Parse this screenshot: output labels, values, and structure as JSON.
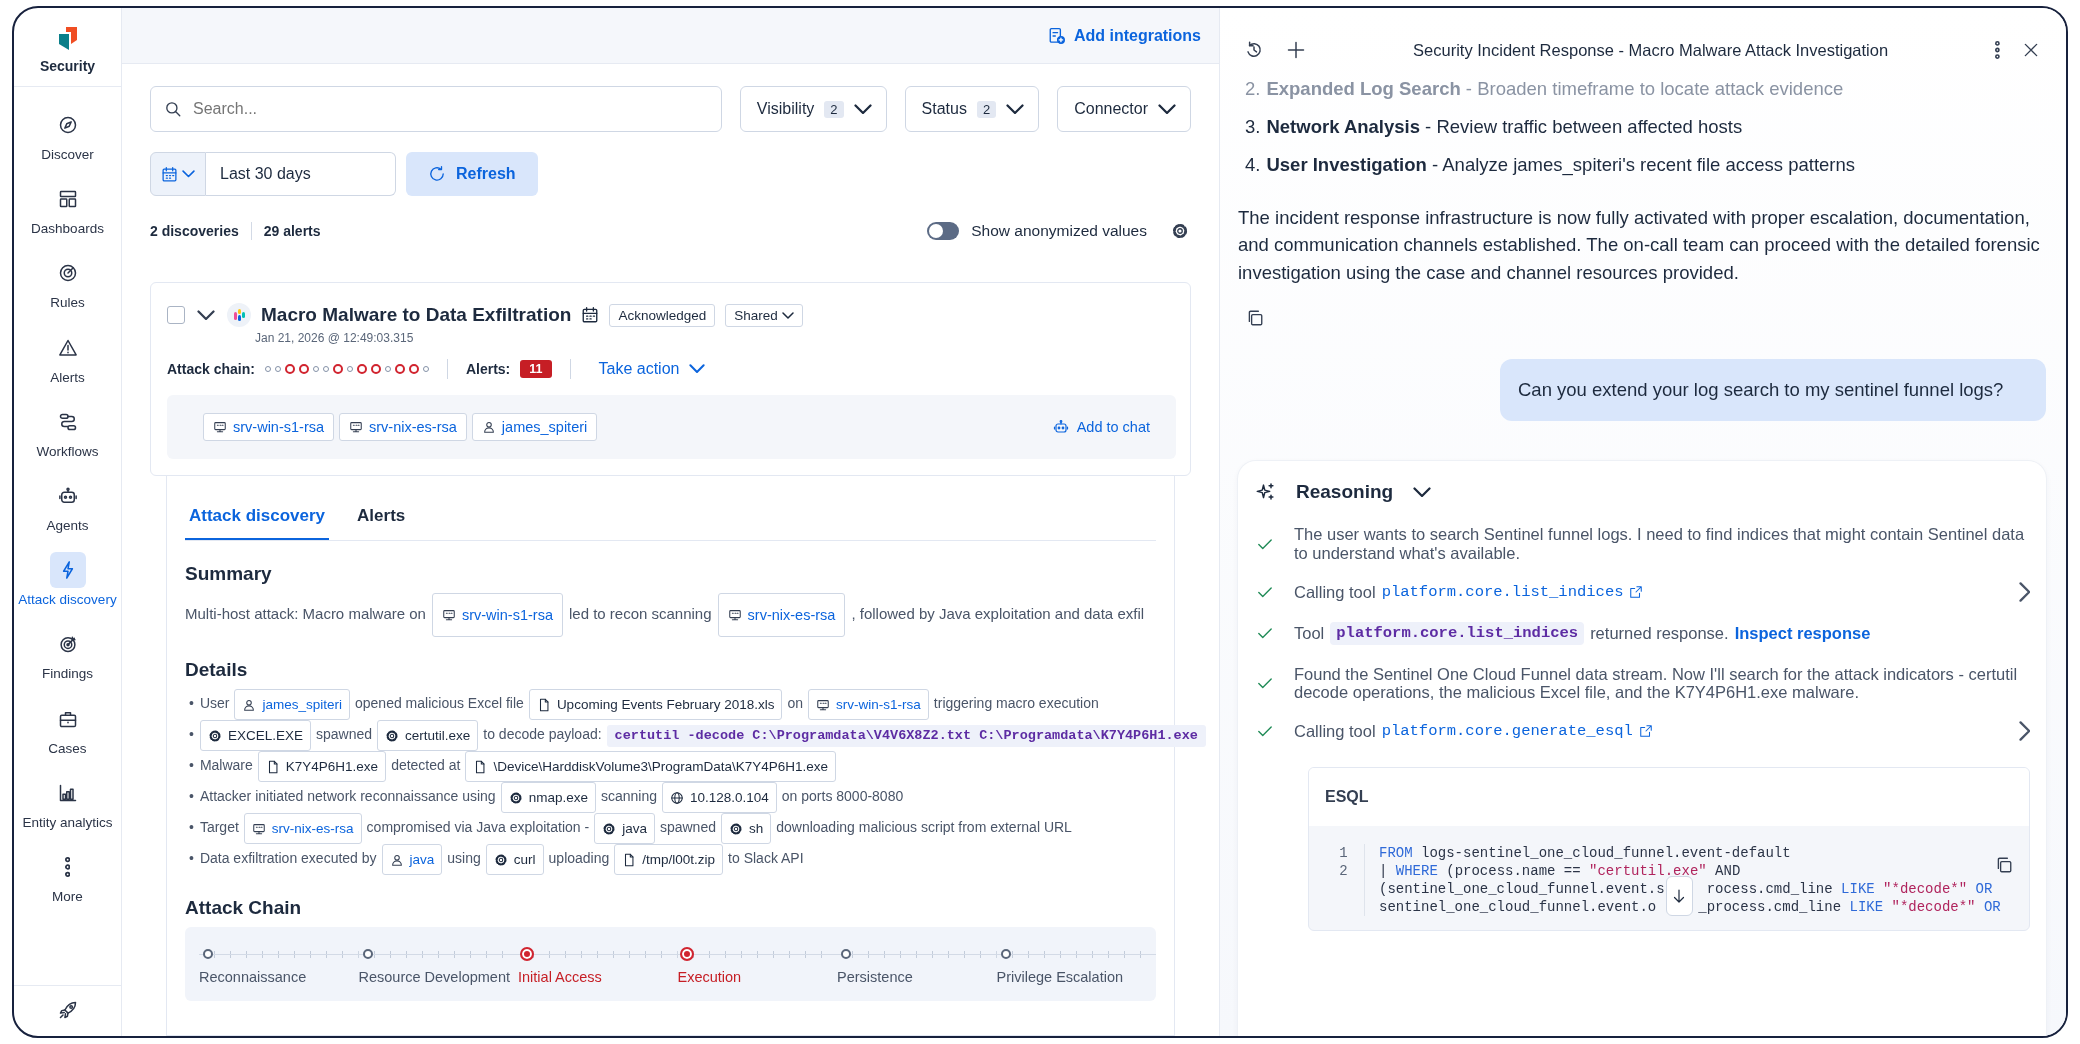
{
  "sidebar": {
    "app_name": "Security",
    "items": [
      {
        "label": "Discover",
        "selected": false
      },
      {
        "label": "Dashboards",
        "selected": false
      },
      {
        "label": "Rules",
        "selected": false
      },
      {
        "label": "Alerts",
        "selected": false
      },
      {
        "label": "Workflows",
        "selected": false
      },
      {
        "label": "Agents",
        "selected": false
      },
      {
        "label": "Attack discovery",
        "selected": true
      },
      {
        "label": "Findings",
        "selected": false
      },
      {
        "label": "Cases",
        "selected": false
      },
      {
        "label": "Entity analytics",
        "selected": false
      },
      {
        "label": "More",
        "selected": false
      }
    ]
  },
  "header": {
    "link": "Add integrations"
  },
  "search": {
    "placeholder": "Search..."
  },
  "filters": [
    {
      "label": "Visibility",
      "count": "2"
    },
    {
      "label": "Status",
      "count": "2"
    },
    {
      "label": "Connector"
    }
  ],
  "date_range": {
    "value": "Last 30 days"
  },
  "refresh_button": "Refresh",
  "summary_counts": [
    "2 discoveries",
    "29 alerts"
  ],
  "anonymize_toggle": {
    "label": "Show anonymized values",
    "on": false
  },
  "discovery": {
    "checked": false,
    "expanded": true,
    "title": "Macro Malware to Data Exfiltration",
    "status": "Acknowledged",
    "sharing": "Shared",
    "timestamp": "Jan 21, 2026 @ 12:49:03.315",
    "attack_chain_label": "Attack chain:",
    "chain_dots": [
      {
        "hit": false
      },
      {
        "hit": false
      },
      {
        "hit": true
      },
      {
        "hit": true
      },
      {
        "hit": false
      },
      {
        "hit": false
      },
      {
        "hit": true
      },
      {
        "hit": false
      },
      {
        "hit": true
      },
      {
        "hit": true
      },
      {
        "hit": false
      },
      {
        "hit": true
      },
      {
        "hit": true
      },
      {
        "hit": false
      }
    ],
    "alerts_label": "Alerts:",
    "alerts_count": "11",
    "take_action": "Take action",
    "entities": [
      {
        "kind": "host",
        "label": "srv-win-s1-rsa"
      },
      {
        "kind": "host",
        "label": "srv-nix-es-rsa"
      },
      {
        "kind": "user",
        "label": "james_spiteri"
      }
    ],
    "add_to_chat": "Add to chat"
  },
  "tabs": [
    {
      "label": "Attack discovery",
      "selected": true
    },
    {
      "label": "Alerts",
      "selected": false
    }
  ],
  "summary": {
    "heading": "Summary",
    "segments": [
      {
        "kind": "text",
        "text": "Multi-host attack: Macro malware on"
      },
      {
        "kind": "host",
        "text": "srv-win-s1-rsa"
      },
      {
        "kind": "text",
        "text": "led to recon scanning"
      },
      {
        "kind": "host",
        "text": "srv-nix-es-rsa"
      },
      {
        "kind": "text",
        "text": ", followed by Java exploitation and data exfil"
      }
    ]
  },
  "details": {
    "heading": "Details",
    "items": [
      {
        "marker": "•",
        "segments": [
          {
            "kind": "text",
            "text": "User"
          },
          {
            "kind": "user",
            "text": "james_spiteri"
          },
          {
            "kind": "text",
            "text": "opened malicious Excel file"
          },
          {
            "kind": "file",
            "text": "Upcoming Events February 2018.xls"
          },
          {
            "kind": "text",
            "text": "on"
          },
          {
            "kind": "host",
            "text": "srv-win-s1-rsa"
          },
          {
            "kind": "text",
            "text": "triggering macro execution"
          }
        ]
      },
      {
        "marker": "•",
        "segments": [
          {
            "kind": "process",
            "text": "EXCEL.EXE"
          },
          {
            "kind": "text",
            "text": "spawned"
          },
          {
            "kind": "process",
            "text": "certutil.exe"
          },
          {
            "kind": "text",
            "text": "to decode payload:"
          },
          {
            "kind": "code",
            "text": "certutil -decode C:\\Programdata\\V4V6X8Z2.txt C:\\Programdata\\K7Y4P6H1.exe"
          }
        ]
      },
      {
        "marker": "•",
        "segments": [
          {
            "kind": "text",
            "text": "Malware"
          },
          {
            "kind": "file",
            "text": "K7Y4P6H1.exe"
          },
          {
            "kind": "text",
            "text": "detected at"
          },
          {
            "kind": "file",
            "text": "\\Device\\HarddiskVolume3\\ProgramData\\K7Y4P6H1.exe"
          }
        ]
      },
      {
        "marker": "•",
        "segments": [
          {
            "kind": "text",
            "text": "Attacker initiated network reconnaissance using"
          },
          {
            "kind": "process",
            "text": "nmap.exe"
          },
          {
            "kind": "text",
            "text": "scanning"
          },
          {
            "kind": "ip",
            "text": "10.128.0.104"
          },
          {
            "kind": "text",
            "text": "on ports 8000-8080"
          }
        ]
      },
      {
        "marker": "•",
        "segments": [
          {
            "kind": "text",
            "text": "Target"
          },
          {
            "kind": "host",
            "text": "srv-nix-es-rsa"
          },
          {
            "kind": "text",
            "text": "compromised via Java exploitation -"
          },
          {
            "kind": "process",
            "text": "java"
          },
          {
            "kind": "text",
            "text": "spawned"
          },
          {
            "kind": "process",
            "text": "sh"
          },
          {
            "kind": "text",
            "text": "downloading malicious script from external URL"
          }
        ]
      },
      {
        "marker": "•",
        "segments": [
          {
            "kind": "text",
            "text": "Data exfiltration executed by"
          },
          {
            "kind": "user",
            "text": "java"
          },
          {
            "kind": "text",
            "text": "using"
          },
          {
            "kind": "process",
            "text": "curl"
          },
          {
            "kind": "text",
            "text": "uploading"
          },
          {
            "kind": "file",
            "text": "/tmp/l00t.zip"
          },
          {
            "kind": "text",
            "text": "to Slack API"
          }
        ]
      }
    ]
  },
  "attack_chain": {
    "heading": "Attack Chain",
    "tactics": [
      {
        "name": "Reconnaissance",
        "hit": false
      },
      {
        "name": "Resource Development",
        "hit": false
      },
      {
        "name": "Initial Access",
        "hit": true
      },
      {
        "name": "Execution",
        "hit": true
      },
      {
        "name": "Persistence",
        "hit": false
      },
      {
        "name": "Privilege Escalation",
        "hit": false
      }
    ]
  },
  "chat": {
    "title": "Security Incident Response - Macro Malware Attack Investigation",
    "list": [
      {
        "number": "2.",
        "text": "**Expanded Log Search** - Broaden timeframe to locate attack evidence"
      },
      {
        "number": "3.",
        "text": "**Network Analysis** - Review traffic between affected hosts"
      },
      {
        "number": "4.",
        "text": "**User Investigation** - Analyze james_spiteri's recent file access patterns"
      }
    ],
    "paragraph": "The incident response infrastructure is now fully activated with proper escalation, documentation, and communication channels established. The on-call team can proceed with the detailed forensic investigation using the case and channel resources provided.",
    "user_message": "Can you extend your log search to my sentinel funnel logs?",
    "reasoning": {
      "title": "Reasoning",
      "expanded": true,
      "steps": [
        {
          "kind": "text",
          "done": true,
          "text": "The user wants to search Sentinel funnel logs. I need to find indices that might contain Sentinel data to understand what's available."
        },
        {
          "kind": "tool_call",
          "done": true,
          "prefix": "Calling tool",
          "tool": "platform.core.list_indices"
        },
        {
          "kind": "tool_result",
          "done": true,
          "prefix": "Tool",
          "tool": "platform.core.list_indices",
          "suffix": "returned response.",
          "link": "Inspect response"
        },
        {
          "kind": "text",
          "done": true,
          "text": "Found the Sentinel One Cloud Funnel data stream. Now I'll search for the attack indicators - certutil decode operations, the malicious Excel file, and the K7Y4P6H1.exe malware."
        },
        {
          "kind": "tool_call",
          "done": true,
          "prefix": "Calling tool",
          "tool": "platform.core.generate_esql"
        }
      ],
      "code": {
        "title": "ESQL",
        "lines": [
          {
            "number": "1",
            "parts": [
              {
                "kind": "keyword",
                "text": "FROM"
              },
              {
                "kind": "plain",
                "text": " logs-sentinel_one_cloud_funnel.event-default"
              }
            ]
          },
          {
            "number": "2",
            "parts": [
              {
                "kind": "plain",
                "text": "| "
              },
              {
                "kind": "keyword",
                "text": "WHERE"
              },
              {
                "kind": "plain",
                "text": " (process.name == "
              },
              {
                "kind": "string",
                "text": "\"certutil.exe\""
              },
              {
                "kind": "plain",
                "text": " AND"
              }
            ]
          },
          {
            "parts": [
              {
                "kind": "plain",
                "text": "(sentinel_one_cloud_funnel.event.s"
              },
              {
                "kind": "gap"
              },
              {
                "kind": "plain",
                "text": "rocess.cmd_line "
              },
              {
                "kind": "keyword",
                "text": "LIKE"
              },
              {
                "kind": "string",
                "text": " \"*decode*\""
              },
              {
                "kind": "keyword",
                "text": " OR"
              }
            ]
          },
          {
            "parts": [
              {
                "kind": "plain",
                "text": "sentinel_one_cloud_funnel.event.o"
              },
              {
                "kind": "gap"
              },
              {
                "kind": "plain",
                "text": "_process.cmd_line "
              },
              {
                "kind": "keyword",
                "text": "LIKE"
              },
              {
                "kind": "string",
                "text": " \"*decode*\""
              },
              {
                "kind": "keyword",
                "text": " OR"
              }
            ]
          }
        ]
      }
    }
  }
}
